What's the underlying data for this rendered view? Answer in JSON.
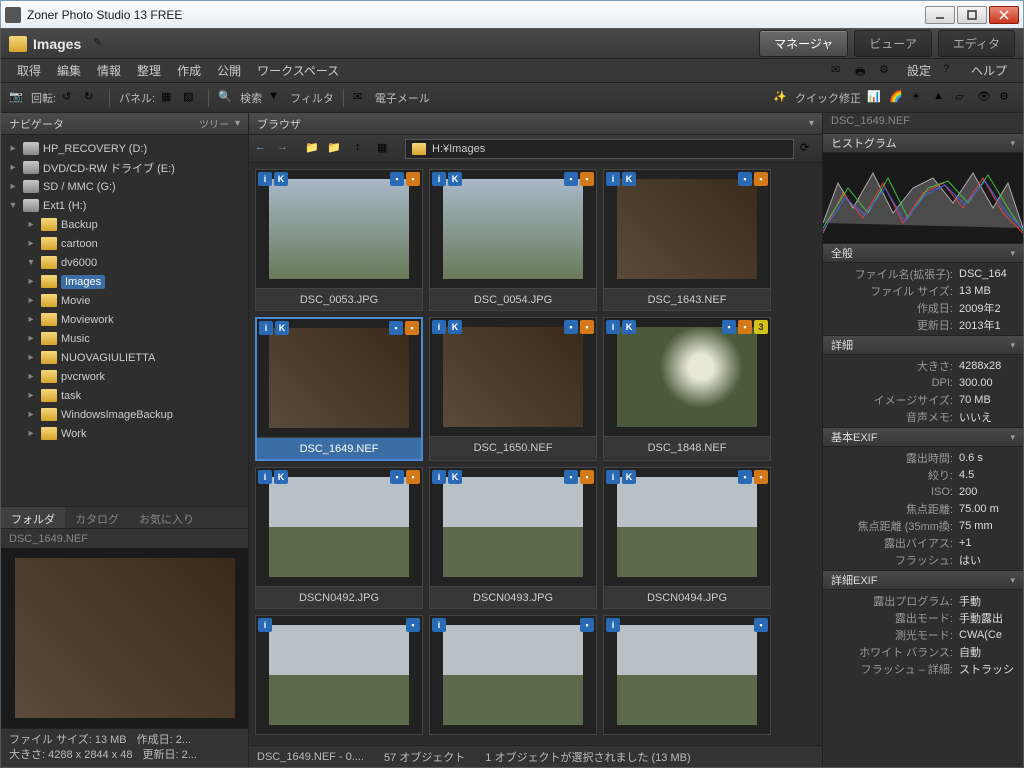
{
  "window": {
    "title": "Zoner Photo Studio 13 FREE"
  },
  "location": {
    "name": "Images"
  },
  "modes": {
    "manager": "マネージャ",
    "viewer": "ビューア",
    "editor": "エディタ"
  },
  "menu": {
    "acquire": "取得",
    "edit": "編集",
    "info": "情報",
    "organize": "整理",
    "create": "作成",
    "publish": "公開",
    "workspace": "ワークスペース",
    "settings": "設定",
    "help": "ヘルプ"
  },
  "toolbar": {
    "rotate": "回転:",
    "panel": "パネル:",
    "search": "検索",
    "filter": "フィルタ",
    "email": "電子メール",
    "quickfix": "クイック修正"
  },
  "navigator": {
    "title": "ナビゲータ",
    "treebtn": "ツリー",
    "nodes": [
      {
        "label": "HP_RECOVERY (D:)",
        "depth": 0,
        "drive": true
      },
      {
        "label": "DVD/CD-RW ドライブ (E:)",
        "depth": 0,
        "drive": true
      },
      {
        "label": "SD / MMC (G:)",
        "depth": 0,
        "drive": true
      },
      {
        "label": "Ext1 (H:)",
        "depth": 0,
        "drive": true,
        "open": true
      },
      {
        "label": "Backup",
        "depth": 1
      },
      {
        "label": "cartoon",
        "depth": 1
      },
      {
        "label": "dv6000",
        "depth": 1,
        "exp": true
      },
      {
        "label": "Images",
        "depth": 1,
        "sel": true
      },
      {
        "label": "Movie",
        "depth": 1
      },
      {
        "label": "Moviework",
        "depth": 1
      },
      {
        "label": "Music",
        "depth": 1
      },
      {
        "label": "NUOVAGIULIETTA",
        "depth": 1
      },
      {
        "label": "pvcrwork",
        "depth": 1
      },
      {
        "label": "task",
        "depth": 1
      },
      {
        "label": "WindowsImageBackup",
        "depth": 1
      },
      {
        "label": "Work",
        "depth": 1
      }
    ],
    "tabs": {
      "folder": "フォルダ",
      "catalog": "カタログ",
      "fav": "お気に入り"
    }
  },
  "preview": {
    "filename": "DSC_1649.NEF",
    "meta1a": "ファイル サイズ: 13 MB",
    "meta1b": "作成日: 2...",
    "meta2a": "大きさ: 4288 x 2844 x 48",
    "meta2b": "更新日: 2..."
  },
  "browser": {
    "title": "ブラウザ",
    "path": "H:¥Images",
    "thumbs": [
      {
        "name": "DSC_0053.JPG",
        "kind": "out"
      },
      {
        "name": "DSC_0054.JPG",
        "kind": "out"
      },
      {
        "name": "DSC_1643.NEF",
        "kind": "in"
      },
      {
        "name": "DSC_1649.NEF",
        "kind": "in",
        "sel": true
      },
      {
        "name": "DSC_1650.NEF",
        "kind": "in"
      },
      {
        "name": "DSC_1848.NEF",
        "kind": "flower",
        "rating": "3"
      },
      {
        "name": "DSCN0492.JPG",
        "kind": "bridge"
      },
      {
        "name": "DSCN0493.JPG",
        "kind": "bridge"
      },
      {
        "name": "DSCN0494.JPG",
        "kind": "bridge"
      }
    ],
    "status1": "DSC_1649.NEF - 0....",
    "status2": "57 オブジェクト",
    "status3": "1 オブジェクトが選択されました (13 MB)"
  },
  "info": {
    "filename": "DSC_1649.NEF",
    "histogram": "ヒストグラム",
    "sections": {
      "general": "全般",
      "detail": "詳細",
      "exif": "基本EXIF",
      "exif2": "詳細EXIF"
    },
    "general": [
      {
        "k": "ファイル名(拡張子):",
        "v": "DSC_164"
      },
      {
        "k": "ファイル サイズ:",
        "v": "13 MB"
      },
      {
        "k": "作成日:",
        "v": "2009年2"
      },
      {
        "k": "更新日:",
        "v": "2013年1"
      }
    ],
    "detail": [
      {
        "k": "大きさ:",
        "v": "4288x28"
      },
      {
        "k": "DPI:",
        "v": "300.00"
      },
      {
        "k": "イメージサイズ:",
        "v": "70 MB"
      },
      {
        "k": "音声メモ:",
        "v": "いいえ"
      }
    ],
    "exif": [
      {
        "k": "露出時間:",
        "v": "0.6 s"
      },
      {
        "k": "絞り:",
        "v": "4.5"
      },
      {
        "k": "ISO:",
        "v": "200"
      },
      {
        "k": "焦点距離:",
        "v": "75.00 m"
      },
      {
        "k": "焦点距離 (35mm換:",
        "v": "75 mm"
      },
      {
        "k": "露出バイアス:",
        "v": "+1"
      },
      {
        "k": "フラッシュ:",
        "v": "はい"
      }
    ],
    "exif2": [
      {
        "k": "露出プログラム:",
        "v": "手動"
      },
      {
        "k": "露出モード:",
        "v": "手動露出"
      },
      {
        "k": "測光モード:",
        "v": "CWA(Ce"
      },
      {
        "k": "ホワイト バランス:",
        "v": "自動"
      },
      {
        "k": "フラッシュ – 詳細:",
        "v": "ストラッシュ"
      }
    ]
  }
}
